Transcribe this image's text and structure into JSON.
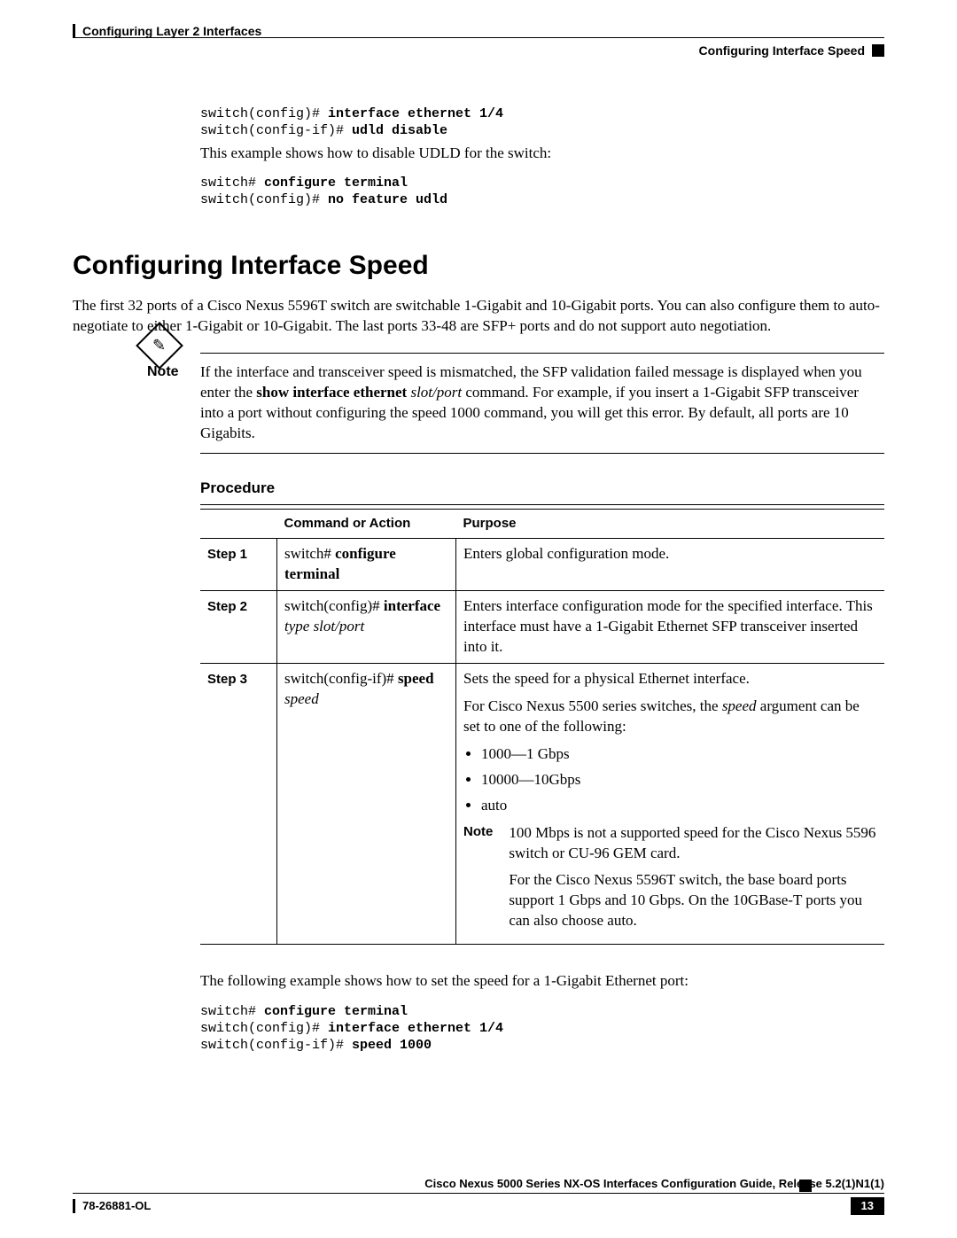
{
  "header": {
    "chapter": "Configuring Layer 2 Interfaces",
    "section": "Configuring Interface Speed"
  },
  "example1": {
    "line1_prompt": "switch(config)# ",
    "line1_cmd": "interface ethernet 1/4",
    "line2_prompt": "switch(config-if)# ",
    "line2_cmd": "udld disable",
    "caption": "This example shows how to disable UDLD for the switch:"
  },
  "example2": {
    "line1_prompt": "switch# ",
    "line1_cmd": "configure terminal",
    "line2_prompt": "switch(config)# ",
    "line2_cmd": "no feature udld"
  },
  "heading": "Configuring Interface Speed",
  "intro": "The first 32 ports of a Cisco Nexus 5596T switch are switchable 1-Gigabit and 10-Gigabit ports. You can also configure them to auto-negotiate to either 1-Gigabit or 10-Gigabit. The last ports 33-48 are SFP+ ports and do not support auto negotiation.",
  "note": {
    "label": "Note",
    "text_pre": "If the interface and transceiver speed is mismatched, the SFP validation failed message is displayed when you enter the ",
    "cmd_b": "show interface ethernet",
    "cmd_i": " slot/port ",
    "text_post": " command. For example, if you insert a 1-Gigabit SFP transceiver into a port without configuring the speed 1000 command, you will get this error. By default, all ports are 10 Gigabits."
  },
  "procedure_label": "Procedure",
  "table": {
    "headers": {
      "blank": "",
      "cmd": "Command or Action",
      "purpose": "Purpose"
    },
    "rows": [
      {
        "step": "Step 1",
        "cmd_prompt": "switch# ",
        "cmd_bold": "configure terminal",
        "cmd_italic": "",
        "purpose_text": "Enters global configuration mode."
      },
      {
        "step": "Step 2",
        "cmd_prompt": "switch(config)# ",
        "cmd_bold": "interface",
        "cmd_italic": "type slot/port",
        "purpose_text": "Enters interface configuration mode for the specified interface. This interface must have a 1-Gigabit Ethernet SFP transceiver inserted into it."
      },
      {
        "step": "Step 3",
        "cmd_prompt": "switch(config-if)# ",
        "cmd_bold": "speed",
        "cmd_italic": "speed",
        "purpose_text1": "Sets the speed for a physical Ethernet interface.",
        "purpose_text2_pre": "For Cisco Nexus 5500 series switches, the ",
        "purpose_text2_i": "speed",
        "purpose_text2_post": " argument can be set to one of the following:",
        "bullets": [
          "1000—1 Gbps",
          "10000—10Gbps",
          "auto"
        ],
        "inner_note_label": "Note",
        "inner_note_p1": "100 Mbps is not a supported speed for the Cisco Nexus 5596 switch or CU-96 GEM card.",
        "inner_note_p2": "For the Cisco Nexus 5596T switch, the base board ports support 1 Gbps and 10 Gbps. On the 10GBase-T ports you can also choose auto."
      }
    ]
  },
  "example3": {
    "caption": "The following example shows how to set the speed for a 1-Gigabit Ethernet port:",
    "line1_prompt": "switch# ",
    "line1_cmd": "configure terminal",
    "line2_prompt": "switch(config)# ",
    "line2_cmd": "interface ethernet 1/4",
    "line3_prompt": "switch(config-if)# ",
    "line3_cmd": "speed 1000"
  },
  "footer": {
    "guide": "Cisco Nexus 5000 Series NX-OS Interfaces Configuration Guide, Release 5.2(1)N1(1)",
    "doc": "78-26881-OL",
    "page": "13"
  }
}
